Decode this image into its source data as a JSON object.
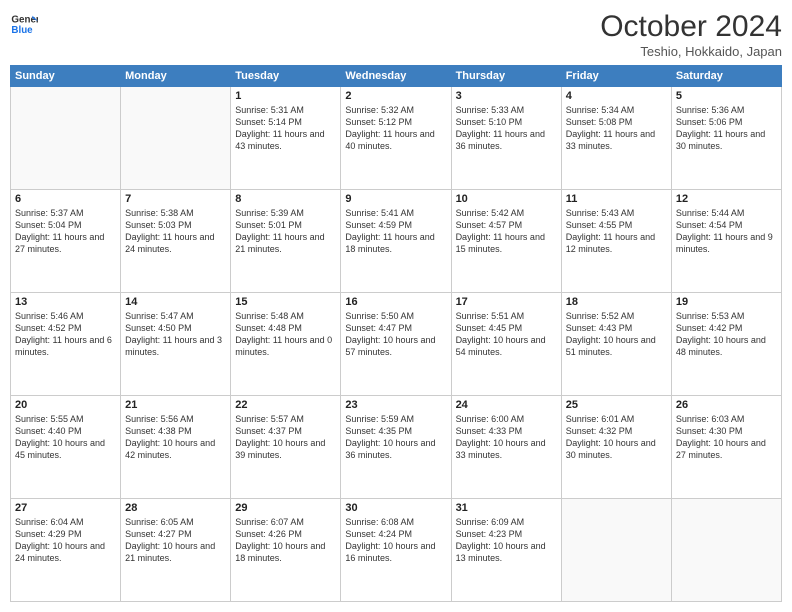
{
  "header": {
    "logo_line1": "General",
    "logo_line2": "Blue",
    "month": "October 2024",
    "location": "Teshio, Hokkaido, Japan"
  },
  "weekdays": [
    "Sunday",
    "Monday",
    "Tuesday",
    "Wednesday",
    "Thursday",
    "Friday",
    "Saturday"
  ],
  "weeks": [
    [
      {
        "day": "",
        "info": ""
      },
      {
        "day": "",
        "info": ""
      },
      {
        "day": "1",
        "info": "Sunrise: 5:31 AM\nSunset: 5:14 PM\nDaylight: 11 hours and 43 minutes."
      },
      {
        "day": "2",
        "info": "Sunrise: 5:32 AM\nSunset: 5:12 PM\nDaylight: 11 hours and 40 minutes."
      },
      {
        "day": "3",
        "info": "Sunrise: 5:33 AM\nSunset: 5:10 PM\nDaylight: 11 hours and 36 minutes."
      },
      {
        "day": "4",
        "info": "Sunrise: 5:34 AM\nSunset: 5:08 PM\nDaylight: 11 hours and 33 minutes."
      },
      {
        "day": "5",
        "info": "Sunrise: 5:36 AM\nSunset: 5:06 PM\nDaylight: 11 hours and 30 minutes."
      }
    ],
    [
      {
        "day": "6",
        "info": "Sunrise: 5:37 AM\nSunset: 5:04 PM\nDaylight: 11 hours and 27 minutes."
      },
      {
        "day": "7",
        "info": "Sunrise: 5:38 AM\nSunset: 5:03 PM\nDaylight: 11 hours and 24 minutes."
      },
      {
        "day": "8",
        "info": "Sunrise: 5:39 AM\nSunset: 5:01 PM\nDaylight: 11 hours and 21 minutes."
      },
      {
        "day": "9",
        "info": "Sunrise: 5:41 AM\nSunset: 4:59 PM\nDaylight: 11 hours and 18 minutes."
      },
      {
        "day": "10",
        "info": "Sunrise: 5:42 AM\nSunset: 4:57 PM\nDaylight: 11 hours and 15 minutes."
      },
      {
        "day": "11",
        "info": "Sunrise: 5:43 AM\nSunset: 4:55 PM\nDaylight: 11 hours and 12 minutes."
      },
      {
        "day": "12",
        "info": "Sunrise: 5:44 AM\nSunset: 4:54 PM\nDaylight: 11 hours and 9 minutes."
      }
    ],
    [
      {
        "day": "13",
        "info": "Sunrise: 5:46 AM\nSunset: 4:52 PM\nDaylight: 11 hours and 6 minutes."
      },
      {
        "day": "14",
        "info": "Sunrise: 5:47 AM\nSunset: 4:50 PM\nDaylight: 11 hours and 3 minutes."
      },
      {
        "day": "15",
        "info": "Sunrise: 5:48 AM\nSunset: 4:48 PM\nDaylight: 11 hours and 0 minutes."
      },
      {
        "day": "16",
        "info": "Sunrise: 5:50 AM\nSunset: 4:47 PM\nDaylight: 10 hours and 57 minutes."
      },
      {
        "day": "17",
        "info": "Sunrise: 5:51 AM\nSunset: 4:45 PM\nDaylight: 10 hours and 54 minutes."
      },
      {
        "day": "18",
        "info": "Sunrise: 5:52 AM\nSunset: 4:43 PM\nDaylight: 10 hours and 51 minutes."
      },
      {
        "day": "19",
        "info": "Sunrise: 5:53 AM\nSunset: 4:42 PM\nDaylight: 10 hours and 48 minutes."
      }
    ],
    [
      {
        "day": "20",
        "info": "Sunrise: 5:55 AM\nSunset: 4:40 PM\nDaylight: 10 hours and 45 minutes."
      },
      {
        "day": "21",
        "info": "Sunrise: 5:56 AM\nSunset: 4:38 PM\nDaylight: 10 hours and 42 minutes."
      },
      {
        "day": "22",
        "info": "Sunrise: 5:57 AM\nSunset: 4:37 PM\nDaylight: 10 hours and 39 minutes."
      },
      {
        "day": "23",
        "info": "Sunrise: 5:59 AM\nSunset: 4:35 PM\nDaylight: 10 hours and 36 minutes."
      },
      {
        "day": "24",
        "info": "Sunrise: 6:00 AM\nSunset: 4:33 PM\nDaylight: 10 hours and 33 minutes."
      },
      {
        "day": "25",
        "info": "Sunrise: 6:01 AM\nSunset: 4:32 PM\nDaylight: 10 hours and 30 minutes."
      },
      {
        "day": "26",
        "info": "Sunrise: 6:03 AM\nSunset: 4:30 PM\nDaylight: 10 hours and 27 minutes."
      }
    ],
    [
      {
        "day": "27",
        "info": "Sunrise: 6:04 AM\nSunset: 4:29 PM\nDaylight: 10 hours and 24 minutes."
      },
      {
        "day": "28",
        "info": "Sunrise: 6:05 AM\nSunset: 4:27 PM\nDaylight: 10 hours and 21 minutes."
      },
      {
        "day": "29",
        "info": "Sunrise: 6:07 AM\nSunset: 4:26 PM\nDaylight: 10 hours and 18 minutes."
      },
      {
        "day": "30",
        "info": "Sunrise: 6:08 AM\nSunset: 4:24 PM\nDaylight: 10 hours and 16 minutes."
      },
      {
        "day": "31",
        "info": "Sunrise: 6:09 AM\nSunset: 4:23 PM\nDaylight: 10 hours and 13 minutes."
      },
      {
        "day": "",
        "info": ""
      },
      {
        "day": "",
        "info": ""
      }
    ]
  ]
}
